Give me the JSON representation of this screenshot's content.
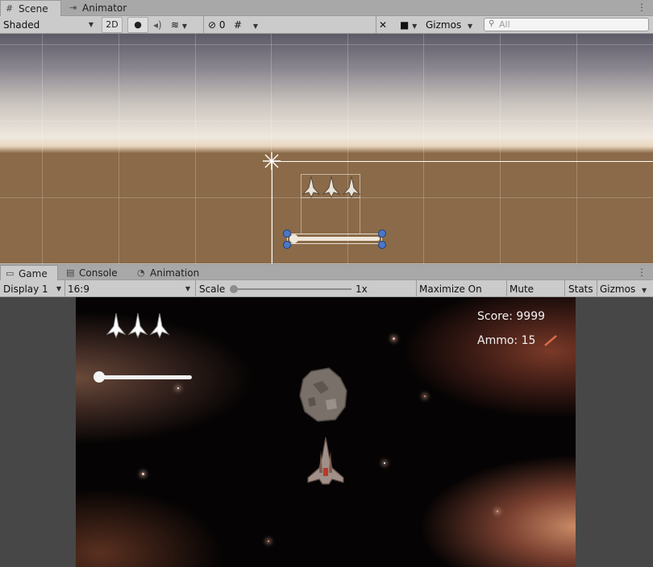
{
  "scene_tabs": [
    {
      "label": "Scene",
      "icon": "grid-icon"
    },
    {
      "label": "Animator",
      "icon": "animator-icon"
    }
  ],
  "scene_toolbar": {
    "shading_mode": "Shaded",
    "mode_2d": "2D",
    "hidden_count": "0",
    "gizmos": "Gizmos",
    "search_placeholder": "All"
  },
  "game_tabs": [
    {
      "label": "Game",
      "icon": "gamepad-icon"
    },
    {
      "label": "Console",
      "icon": "console-icon"
    },
    {
      "label": "Animation",
      "icon": "animation-icon"
    }
  ],
  "game_toolbar": {
    "display": "Display 1",
    "aspect": "16:9",
    "scale_label": "Scale",
    "scale_value": "1x",
    "maximize": "Maximize On Play",
    "mute": "Mute Audio",
    "stats": "Stats",
    "gizmos": "Gizmos"
  },
  "hud": {
    "score": "Score: 9999",
    "ammo": "Ammo: 15",
    "lives": 3,
    "thruster_level": 0.0
  }
}
